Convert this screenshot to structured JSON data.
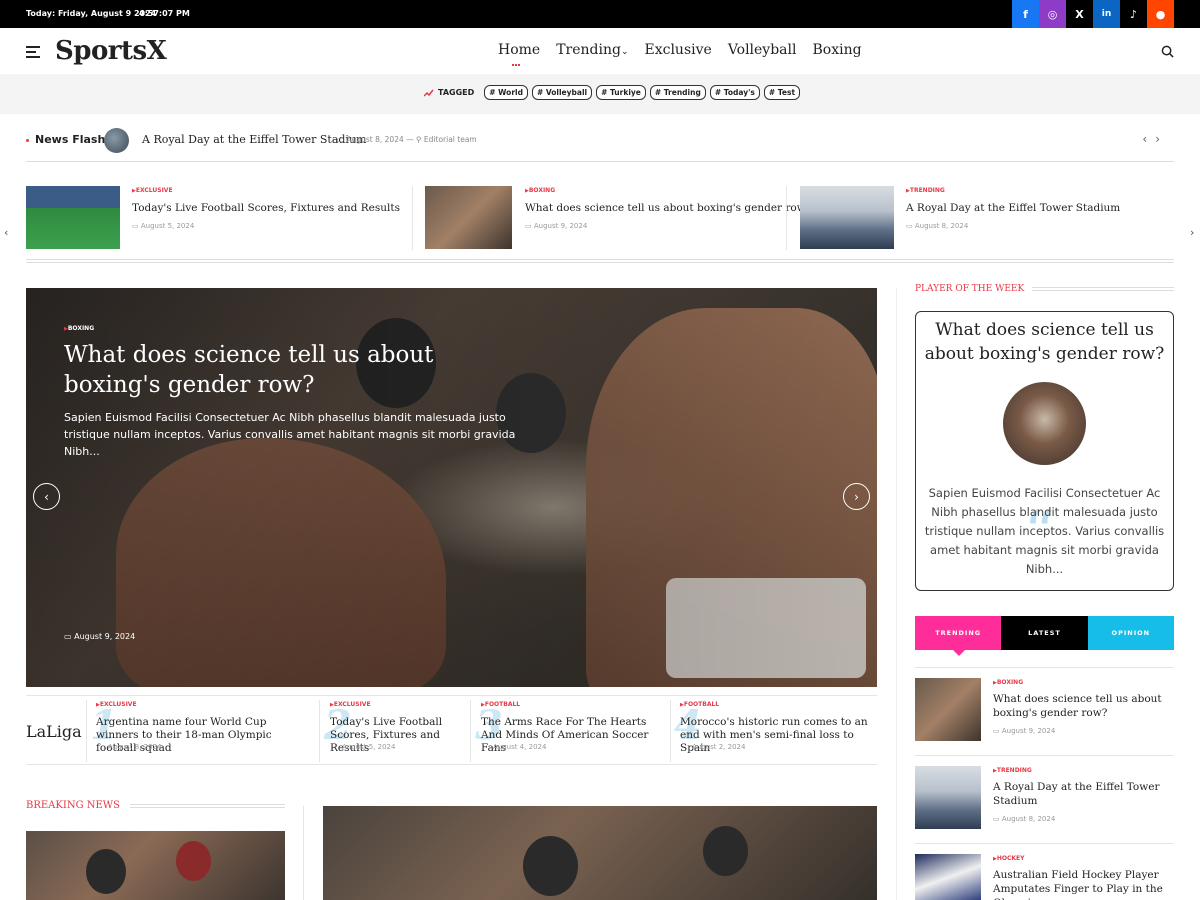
{
  "topbar": {
    "date": "Today: Friday, August 9 2024",
    "time": "4:57:07 PM",
    "social": [
      {
        "icon": "facebook-icon",
        "glyph": "f",
        "color": "#1877f2"
      },
      {
        "icon": "instagram-icon",
        "glyph": "◎",
        "color": "#8e3cc7"
      },
      {
        "icon": "x-icon",
        "glyph": "X",
        "color": "#000000"
      },
      {
        "icon": "linkedin-icon",
        "glyph": "in",
        "color": "#0a66c2"
      },
      {
        "icon": "tiktok-icon",
        "glyph": "♪",
        "color": "#000000"
      },
      {
        "icon": "reddit-icon",
        "glyph": "●",
        "color": "#ff4500"
      }
    ]
  },
  "header": {
    "logo": "SportsX",
    "nav": [
      "Home",
      "Trending",
      "Exclusive",
      "Volleyball",
      "Boxing"
    ],
    "trending_caret": "⌄"
  },
  "tagged": {
    "label": "TAGGED",
    "tags": [
      "# World",
      "# Volleyball",
      "# Turkiye",
      "# Trending",
      "# Today's",
      "# Test"
    ]
  },
  "news_flash": {
    "label": "News Flash",
    "title": "A Royal Day at the Eiffel Tower Stadium",
    "date": "August 8, 2024",
    "separator": "—",
    "author": "Editorial team"
  },
  "mini_posts": [
    {
      "category": "EXCLUSIVE",
      "title": "Today's Live Football Scores, Fixtures and Results",
      "date": "August 5, 2024"
    },
    {
      "category": "BOXING",
      "title": "What does science tell us about boxing's gender row?",
      "date": "August 9, 2024"
    },
    {
      "category": "TRENDING",
      "title": "A Royal Day at the Eiffel Tower Stadium",
      "date": "August 8, 2024"
    }
  ],
  "hero": {
    "category": "BOXING",
    "title": "What does science tell us about boxing's gender row?",
    "excerpt": "Sapien Euismod Facilisi Consectetuer Ac Nibh phasellus blandit malesuada justo tristique nullam inceptos. Varius convallis amet habitant magnis sit morbi gravida Nibh...",
    "date": "August 9, 2024"
  },
  "laliga": {
    "label": "LaLiga",
    "posts": [
      {
        "num": "1",
        "category": "EXCLUSIVE",
        "title": "Argentina name four World Cup winners to their 18-man Olympic football squad",
        "date": "August 8, 2024"
      },
      {
        "num": "2",
        "category": "EXCLUSIVE",
        "title": "Today's Live Football Scores, Fixtures and Results",
        "date": "August 5, 2024"
      },
      {
        "num": "3",
        "category": "FOOTBALL",
        "title": "The Arms Race For The Hearts And Minds Of American Soccer Fans",
        "date": "August 4, 2024"
      },
      {
        "num": "4",
        "category": "FOOTBALL",
        "title": "Morocco's historic run comes to an end with men's semi-final loss to Spain",
        "date": "August 2, 2024"
      }
    ]
  },
  "breaking": {
    "label": "BREAKING NEWS"
  },
  "player_of_week": {
    "label": "PLAYER OF THE WEEK",
    "title": "What does science tell us about boxing's gender row?",
    "excerpt": "Sapien Euismod Facilisi Consectetuer Ac Nibh phasellus blandit malesuada justo tristique nullam inceptos. Varius convallis amet habitant magnis sit morbi gravida Nibh...",
    "quote_mark": "“"
  },
  "tabs": [
    "TRENDING",
    "LATEST",
    "OPINION"
  ],
  "side_posts": [
    {
      "category": "BOXING",
      "title": "What does science tell us about boxing's gender row?",
      "date": "August 9, 2024"
    },
    {
      "category": "TRENDING",
      "title": "A Royal Day at the Eiffel Tower Stadium",
      "date": "August 8, 2024"
    },
    {
      "category": "HOCKEY",
      "title": "Australian Field Hockey Player Amputates Finger to Play in the Olympics"
    }
  ],
  "colors": {
    "accent": "#e63946",
    "trending_tab": "#ff2d9a",
    "latest_tab": "#000000",
    "opinion_tab": "#16bde8"
  }
}
